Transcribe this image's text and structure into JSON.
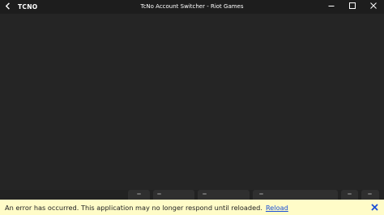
{
  "titlebar": {
    "back_icon": "arrow-left-icon",
    "logo_text": "TCNO",
    "title": "TcNo Account Switcher - Riot Games",
    "minimize_glyph": "—",
    "maximize_glyph": "☐",
    "close_glyph": "✕"
  },
  "toolbar": {
    "buttons": [
      "platform",
      "add",
      "import",
      "settings",
      "launch",
      "upload",
      "help"
    ]
  },
  "error": {
    "message": "An error has occurred. This application may no longer respond until reloaded.",
    "reload_label": "Reload",
    "dismiss_glyph": "🗙",
    "background": "#fffcc8",
    "link_color": "#1a4fd6"
  }
}
